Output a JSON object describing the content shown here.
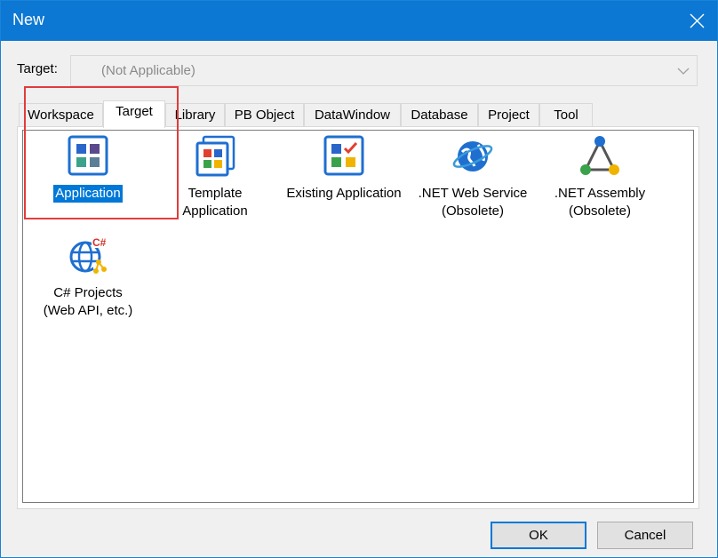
{
  "window": {
    "title": "New"
  },
  "target": {
    "label": "Target:",
    "value": "(Not Applicable)"
  },
  "tabs": [
    "Workspace",
    "Target",
    "Library",
    "PB Object",
    "DataWindow",
    "Database",
    "Project",
    "Tool"
  ],
  "active_tab": "Target",
  "items": [
    {
      "label_lines": [
        "Application"
      ],
      "icon": "application-icon",
      "selected": true
    },
    {
      "label_lines": [
        "Template",
        "Application"
      ],
      "icon": "template-application-icon",
      "selected": false
    },
    {
      "label_lines": [
        "Existing Application"
      ],
      "icon": "existing-application-icon",
      "selected": false
    },
    {
      "label_lines": [
        ".NET Web Service",
        "(Obsolete)"
      ],
      "icon": "web-service-globe-icon",
      "selected": false
    },
    {
      "label_lines": [
        ".NET Assembly",
        "(Obsolete)"
      ],
      "icon": "assembly-triangle-icon",
      "selected": false
    },
    {
      "label_lines": [
        "C# Projects",
        "(Web API, etc.)"
      ],
      "icon": "csharp-projects-icon",
      "selected": false
    }
  ],
  "buttons": {
    "ok": "OK",
    "cancel": "Cancel"
  },
  "colors": {
    "titlebar": "#0c78d3",
    "selection": "#0078d7",
    "highlight_box": "#e23c3c"
  }
}
